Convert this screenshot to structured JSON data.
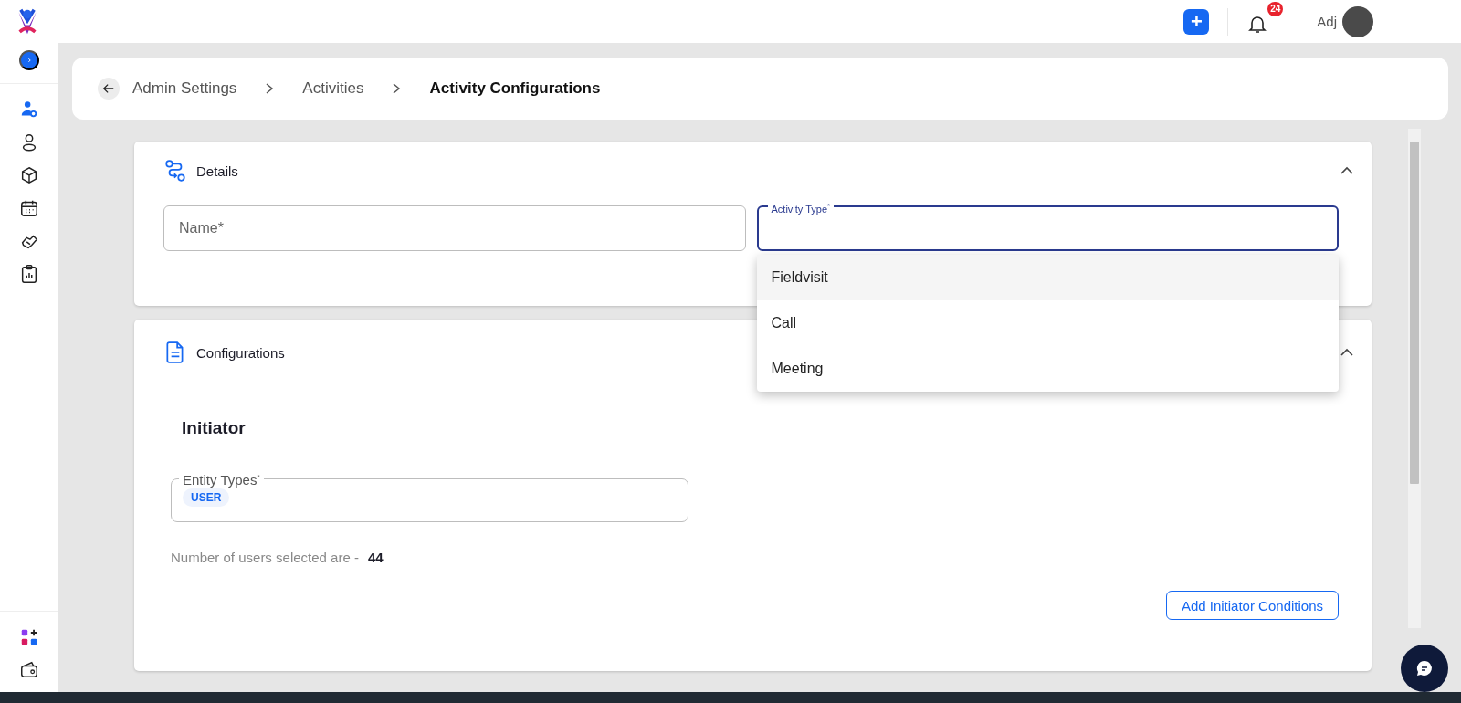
{
  "topbar": {
    "add_button": "+",
    "notification_count": "24",
    "user_name": "Adj"
  },
  "sidebar": {
    "items": [
      {
        "selected": true
      },
      {
        "selected": false
      },
      {
        "selected": false
      },
      {
        "selected": false
      },
      {
        "selected": false
      },
      {
        "selected": false
      }
    ]
  },
  "breadcrumb": [
    {
      "label": "Admin Settings",
      "current": false
    },
    {
      "label": "Activities",
      "current": false
    },
    {
      "label": "Activity Configurations",
      "current": true
    }
  ],
  "details": {
    "title": "Details",
    "expanded": true,
    "fields": [
      {
        "label": "Name*",
        "focused": false
      },
      {
        "label": "Activity Type$^{*}$",
        "focused": true
      }
    ]
  },
  "dropdown": {
    "options": [
      {
        "label": "Fieldvisit",
        "selected": true
      },
      {
        "label": "Call",
        "selected": false
      },
      {
        "label": "Meeting",
        "selected": false
      }
    ]
  },
  "configurations": {
    "title": "Configurations",
    "expanded": true,
    "section_title": "Initiator",
    "entity_field": {
      "label": "Entity Types$^{*}$",
      "chips": [
        "USER"
      ]
    },
    "summary_text": "Number of users selected are -",
    "summary_count": "44",
    "button": "Add Initiator Conditions"
  }
}
